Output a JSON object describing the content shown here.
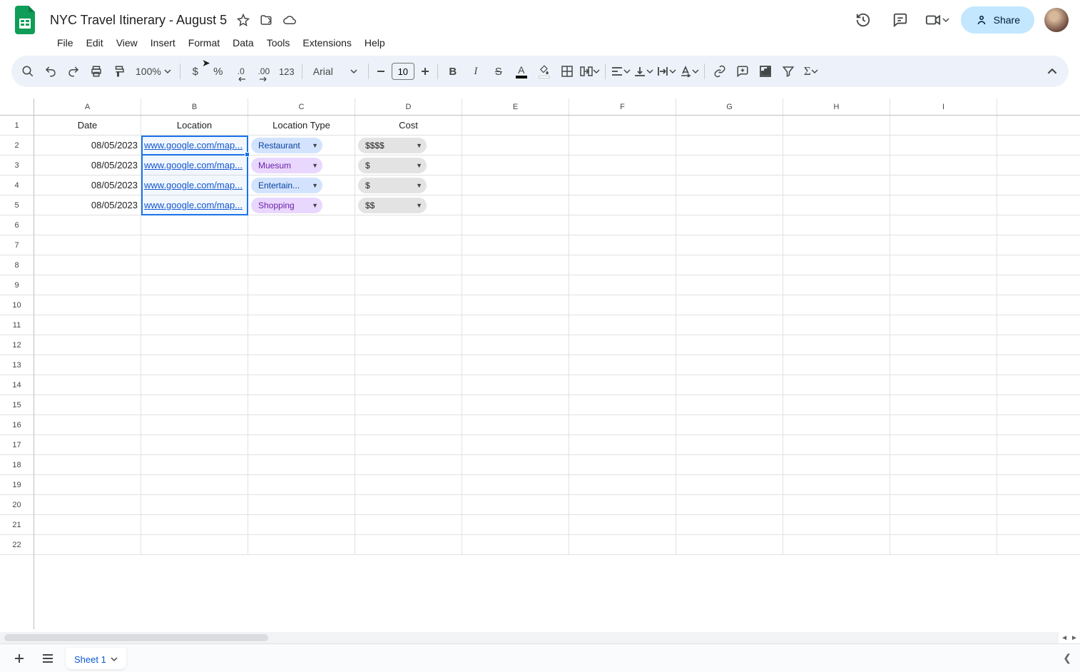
{
  "doc_title": "NYC Travel Itinerary - August 5",
  "menus": [
    "File",
    "Edit",
    "View",
    "Insert",
    "Format",
    "Data",
    "Tools",
    "Extensions",
    "Help"
  ],
  "share_label": "Share",
  "toolbar": {
    "zoom": "100%",
    "font": "Arial",
    "font_size": "10",
    "currency": "$",
    "percent": "%",
    "dec_dec": ".0",
    "inc_dec": ".00",
    "num_fmt": "123"
  },
  "columns": [
    "A",
    "B",
    "C",
    "D",
    "E",
    "F",
    "G",
    "H",
    "I"
  ],
  "row_count": 22,
  "headers": {
    "A": "Date",
    "B": "Location",
    "C": "Location Type",
    "D": "Cost"
  },
  "rows": [
    {
      "date": "08/05/2023",
      "location": "www.google.com/map...",
      "type": "Restaurant",
      "type_color": "blue",
      "cost": "$$$$"
    },
    {
      "date": "08/05/2023",
      "location": "www.google.com/map...",
      "type": "Muesum",
      "type_color": "purple",
      "cost": "$"
    },
    {
      "date": "08/05/2023",
      "location": "www.google.com/map...",
      "type": "Entertain...",
      "type_color": "blue",
      "cost": "$"
    },
    {
      "date": "08/05/2023",
      "location": "www.google.com/map...",
      "type": "Shopping",
      "type_color": "purple",
      "cost": "$$"
    }
  ],
  "sheet_tab": "Sheet 1"
}
